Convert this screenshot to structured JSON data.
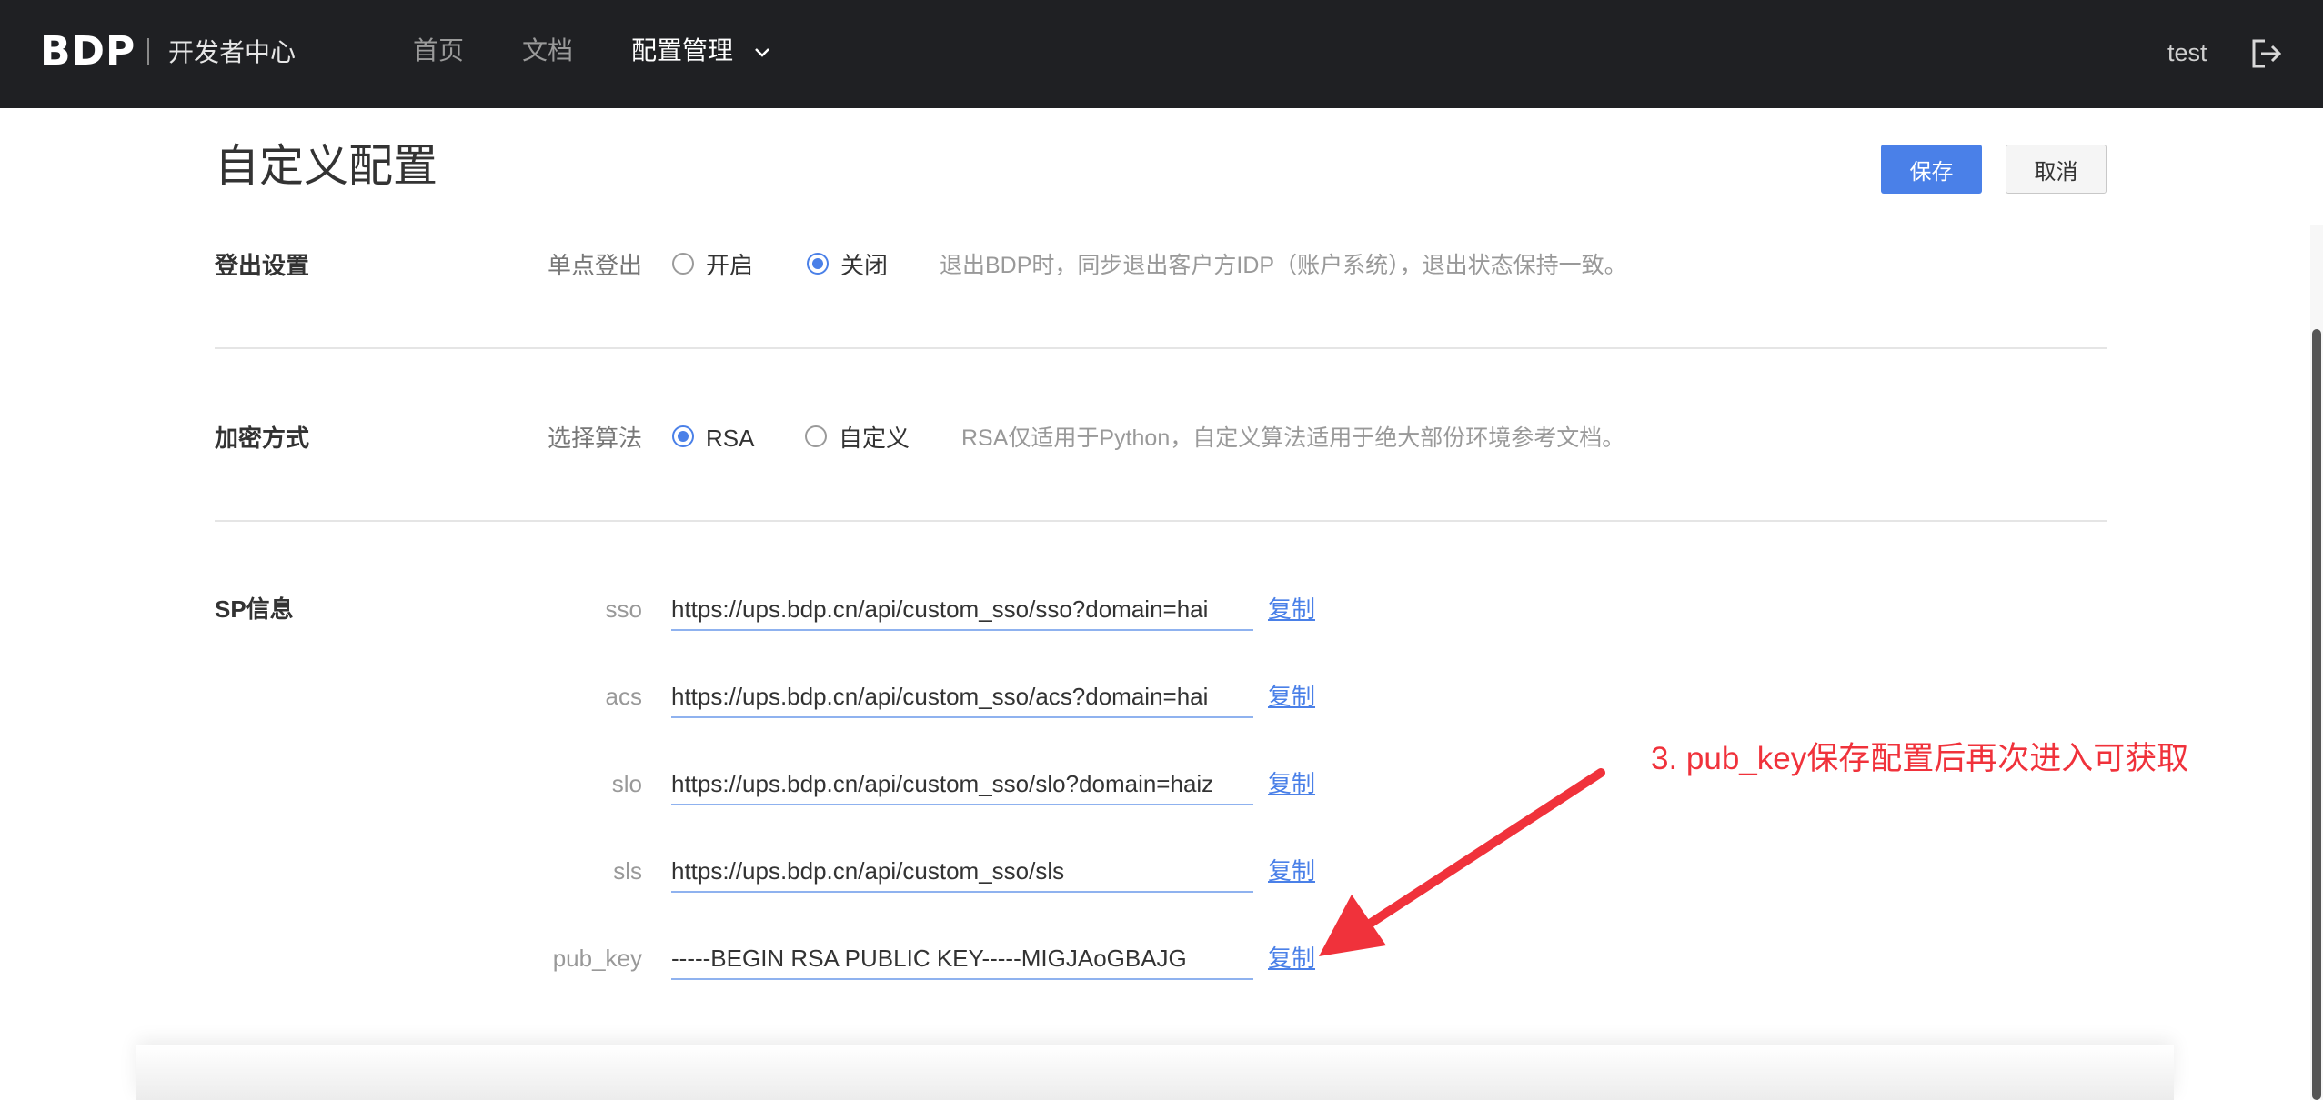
{
  "nav": {
    "logo": "BDP",
    "subtitle": "开发者中心",
    "items": [
      {
        "label": "首页"
      },
      {
        "label": "文档"
      },
      {
        "label": "配置管理"
      }
    ],
    "user": "test",
    "icons": {
      "dropdown": "chevron-down-icon",
      "logout": "logout-icon"
    }
  },
  "header": {
    "title": "自定义配置",
    "save_label": "保存",
    "cancel_label": "取消"
  },
  "logout_settings": {
    "section": "登出设置",
    "label": "单点登出",
    "options": [
      "开启",
      "关闭"
    ],
    "selected": "关闭",
    "hint": "退出BDP时，同步退出客户方IDP（账户系统），退出状态保持一致。"
  },
  "encryption": {
    "section": "加密方式",
    "label": "选择算法",
    "options": [
      "RSA",
      "自定义"
    ],
    "selected": "RSA",
    "hint": "RSA仅适用于Python，自定义算法适用于绝大部份环境参考文档。"
  },
  "sp_info": {
    "section": "SP信息",
    "copy_label": "复制",
    "fields": [
      {
        "label": "sso",
        "value": "https://ups.bdp.cn/api/custom_sso/sso?domain=hai"
      },
      {
        "label": "acs",
        "value": "https://ups.bdp.cn/api/custom_sso/acs?domain=hai"
      },
      {
        "label": "slo",
        "value": "https://ups.bdp.cn/api/custom_sso/slo?domain=haiz"
      },
      {
        "label": "sls",
        "value": "https://ups.bdp.cn/api/custom_sso/sls"
      },
      {
        "label": "pub_key",
        "value": "-----BEGIN RSA PUBLIC KEY-----MIGJAoGBAJG"
      }
    ]
  },
  "annotation": {
    "text": "3. pub_key保存配置后再次进入可获取",
    "color": "#f0323b"
  },
  "colors": {
    "accent": "#4a80e8",
    "nav_bg": "#1f2023"
  }
}
